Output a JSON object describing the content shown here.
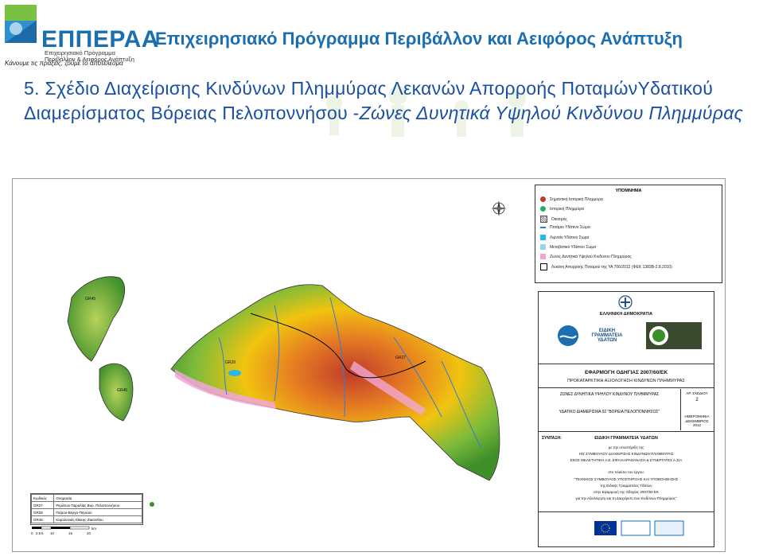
{
  "header": {
    "logo_name": "ΕΠΠΕΡΑΑ",
    "logo_sub1": "Επιχειρησιακό Πρόγραμμα",
    "logo_sub2": "Περιβάλλον & Αειφόρος Ανάπτυξη",
    "logo_slogan": "Κάνουμε τις πράξεις, ζούμε το αποτέλεσμα",
    "program_title": "Επιχειρησιακό Πρόγραμμα Περιβάλλον και Αειφόρος Ανάπτυξη"
  },
  "slide": {
    "title_plain": "5.  Σχέδιο  Διαχείρισης  Κινδύνων  Πλημμύρας  Λεκανών  Απορροής ΠοταμώνΥδατικού Διαμερίσματος Βόρειας Πελοποννήσου -",
    "title_italic": "Ζώνες Δυνητικά Υψηλού Κινδύνου Πλημμύρας"
  },
  "legend": {
    "title": "ΥΠΟΜΝΗΜΑ",
    "items": [
      {
        "label": "Σημαντική Ιστορική Πλημμύρα",
        "color": "#c0392b",
        "kind": "dot"
      },
      {
        "label": "Ιστορική Πλημμύρα",
        "color": "#27ae60",
        "kind": "dot"
      },
      {
        "label": "Οικισμός",
        "color": "#888888",
        "kind": "hatch"
      },
      {
        "label": "Ποτάμιο Υδάτινο Σώμα",
        "color": "#2e7fd1",
        "kind": "line"
      },
      {
        "label": "Λιμναίο Υδάτινο Σώμα",
        "color": "#2ab7e8",
        "kind": "box"
      },
      {
        "label": "Μεταβατικό Υδάτινο Σώμα",
        "color": "#9ad3f0",
        "kind": "box"
      },
      {
        "label": "Ζώνες Δυνητικά Υψηλού Κινδύνου Πλημμύρας",
        "color": "#f1a7d6",
        "kind": "box"
      },
      {
        "label": "Λεκάνη Απορροής Ποταμού της ΥΑ 706/2012 (ΦΕΚ 1383Β-2.8.2010)",
        "color": "#000000",
        "kind": "outline"
      }
    ]
  },
  "info": {
    "republic": "ΕΛΛΗΝΙΚΗ ΔΗΜΟΚΡΑΤΙΑ",
    "secretariat": "ΕΙΔΙΚΗ ΓΡΑΜΜΑΤΕΙΑ ΥΔΑΤΩΝ",
    "directive": "ΕΦΑΡΜΟΓΗ ΟΔΗΓΙΑΣ 2007/60/ΕΚ",
    "assessment": "ΠΡΟΚΑΤΑΡΚΤΙΚΗ ΑΞΙΟΛΟΓΗΣΗ ΚΙΝΔΥΝΩΝ ΠΛΗΜΜΥΡΑΣ",
    "zones": "ΖΩΝΕΣ ΔΥΝΗΤΙΚΑ ΥΨΗΛΟΥ ΚΙΝΔΥΝΟΥ ΠΛΗΜΜΥΡΑΣ",
    "district": "ΥΔΑΤΙΚΟ ΔΙΑΜΕΡΙΣΜΑ 02 \"ΒΟΡΕΙΑ ΠΕΛΟΠΟΝΝΗΣΟΣ\"",
    "sheet_label": "ΑΡ. ΣΧΕΔΙΟΥ",
    "sheet_no": "2",
    "date_label": "ΗΜΕΡΟΜΗΝΙΑ",
    "date": "ΔΕΚΕΜΒΡΙΟΣ 2012",
    "compiled_label": "ΣΥΝΤΑΞΗ:",
    "compiled_by": "ΕΙΔΙΚΗ ΓΡΑΜΜΑΤΕΙΑ ΥΔΑΤΩΝ",
    "support1": "με την υποστήριξη της",
    "support2": "Η/Σ ΣΥΜΒΟΥΛΟΥ ΔΙΑΧΕΙΡΙΣΗΣ ΚΙΝΔΥΝΩΝ ΠΛΗΜΜΥΡΑΣ",
    "support3": "ΕΚΟΣ ΜΕΛΕΤΗΤΙΚΗ Α.Ε. ΕΦΗ ΚΑΡΑΘΑΝΑΣΗ & ΣΥΝΕΡΓΑΤΕΣ Α.ΣΙΑ",
    "project1": "στο πλαίσιο του έργου:",
    "project2": "\"ΤΕΧΝΙΚΟΣ ΣΥΜΒΟΥΛΟΣ ΥΠΟΣΤΗΡΙΞΗΣ ΚΑΙ ΥΠΟΒΟΗΘΗΣΗΣ",
    "project3": "της Ειδικής Γραμματείας Υδάτων",
    "project4": "στην Εφαρμογή της Οδηγίας 2007/60 ΕΚ",
    "project5": "για την Αξιολόγηση και τη Διαχείριση των Κινδύνων Πλημμύρας\""
  },
  "codes_table": {
    "headers": [
      "Κωδικός",
      "Ονομασία"
    ],
    "rows": [
      [
        "GR27",
        "Ρεμάτων Παραλίας Βορ. Πελοποννήσου"
      ],
      [
        "GR28",
        "Πείρου-Βέργα-Πηνειού"
      ],
      [
        "GR45",
        "Κεφαλονιάς-Ιθάκης-Ζακύνθου"
      ]
    ]
  },
  "scale_bar": {
    "ticks": [
      "0",
      "2.5",
      "5",
      "10",
      "15",
      "20"
    ],
    "unit": "km"
  },
  "map_labels": [
    "GR45",
    "GR28",
    "GR27",
    "GR45"
  ],
  "colors": {
    "brand_blue": "#1b6fb1",
    "title_blue": "#1a4fa3",
    "flood_pink": "#f1a7d6"
  }
}
